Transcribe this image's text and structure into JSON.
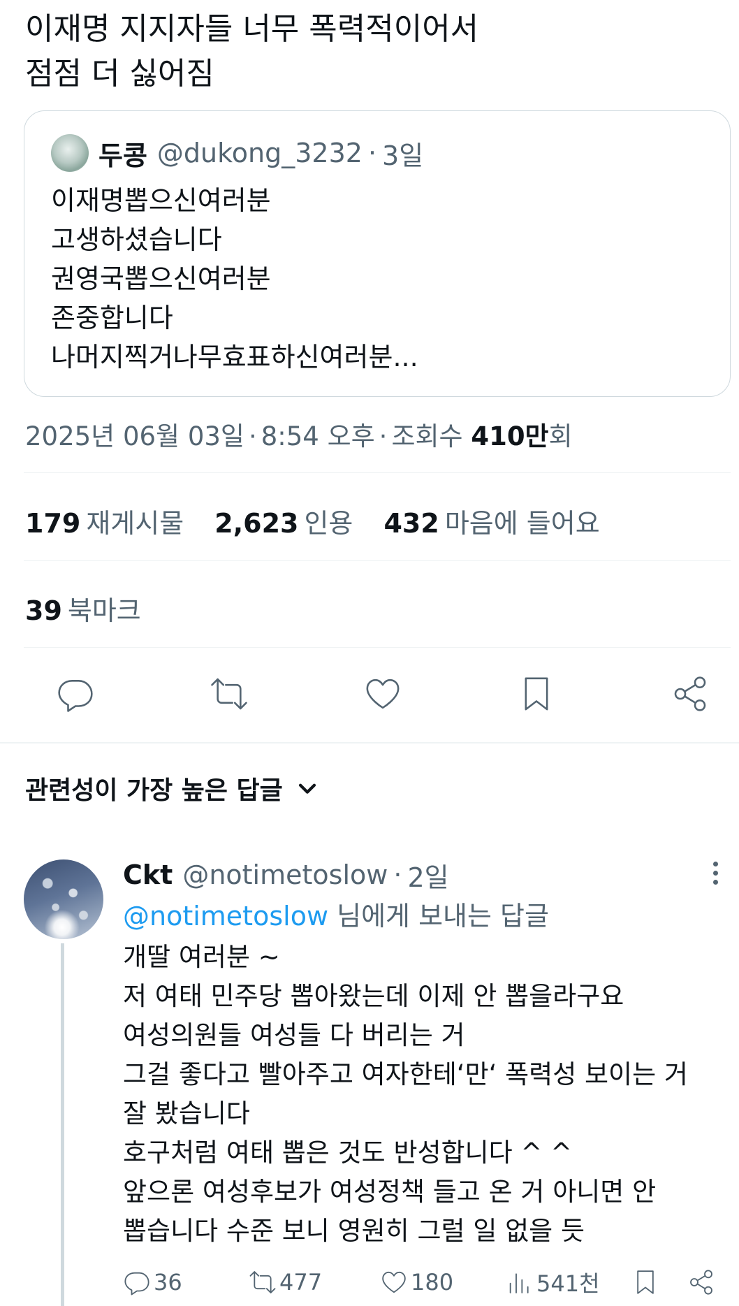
{
  "tweet": {
    "text_lines": [
      "이재명 지지자들 너무 폭력적이어서",
      "점점 더 싫어짐"
    ]
  },
  "quote": {
    "name": "두콩",
    "handle": "@dukong_3232",
    "time": "3일",
    "lines": [
      "이재명뽑으신여러분",
      "고생하셨습니다",
      "권영국뽑으신여러분",
      "존중합니다",
      "나머지찍거나무효표하신여러분..."
    ]
  },
  "meta": {
    "date": "2025년 06월 03일",
    "time": "8:54 오후",
    "views_label": "조회수",
    "views_value": "410만",
    "views_unit": "회"
  },
  "stats": {
    "reposts": {
      "value": "179",
      "label": "재게시물"
    },
    "quotes": {
      "value": "2,623",
      "label": "인용"
    },
    "likes": {
      "value": "432",
      "label": "마음에 들어요"
    },
    "bookmarks": {
      "value": "39",
      "label": "북마크"
    }
  },
  "replies_header": {
    "label": "관련성이 가장 높은 답글"
  },
  "reply": {
    "name": "Ckt",
    "handle": "@notimetoslow",
    "time": "2일",
    "replying_to_handle": "@notimetoslow",
    "replying_to_suffix": " 님에게 보내는 답글",
    "lines": [
      "개딸 여러분 ~",
      "저 여태 민주당 뽑아왔는데 이제 안 뽑을라구요",
      "여성의원들 여성들 다 버리는 거",
      "그걸 좋다고 빨아주고 여자한테‘만‘ 폭력성 보이는 거",
      "잘 봤습니다",
      "호구처럼 여태 뽑은 것도 반성합니다 ^ ^",
      "앞으론 여성후보가 여성정책 들고 온 거 아니면 안",
      "뽑습니다 수준 보니 영원히 그럴 일 없을 듯"
    ],
    "actions": {
      "replies": "36",
      "reposts": "477",
      "likes": "180",
      "views": "541천"
    }
  },
  "colors": {
    "text": "#0f1419",
    "secondary": "#536471",
    "accent": "#1d9bf0",
    "border": "#cfd9de"
  },
  "icons": [
    "reply-icon",
    "repost-icon",
    "like-icon",
    "bookmark-icon",
    "share-icon",
    "chevron-down-icon",
    "more-icon",
    "views-icon"
  ]
}
